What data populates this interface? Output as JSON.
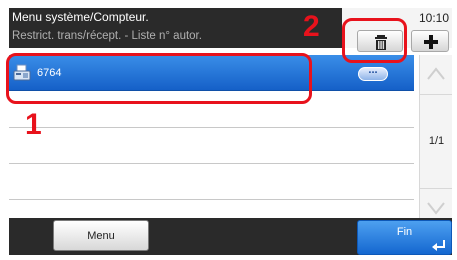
{
  "header": {
    "title": "Menu système/Compteur.",
    "subtitle": "Restrict. trans/récept. - Liste n° autor.",
    "time": "10:10"
  },
  "toolbar": {
    "delete_icon": "trash-icon",
    "add_icon": "plus-icon"
  },
  "list": {
    "items": [
      {
        "label": "6764",
        "icon": "fax-machine-icon",
        "detail_label": "...",
        "selected": true
      },
      {
        "label": ""
      },
      {
        "label": ""
      },
      {
        "label": ""
      }
    ]
  },
  "scroll": {
    "page": "1/1"
  },
  "footer": {
    "menu_label": "Menu",
    "end_label": "Fin"
  },
  "annotations": {
    "one": "1",
    "two": "2",
    "color": "#e8121c"
  },
  "colors": {
    "selected_row": "#1f74d8",
    "header_bg": "#2a2a2a"
  }
}
